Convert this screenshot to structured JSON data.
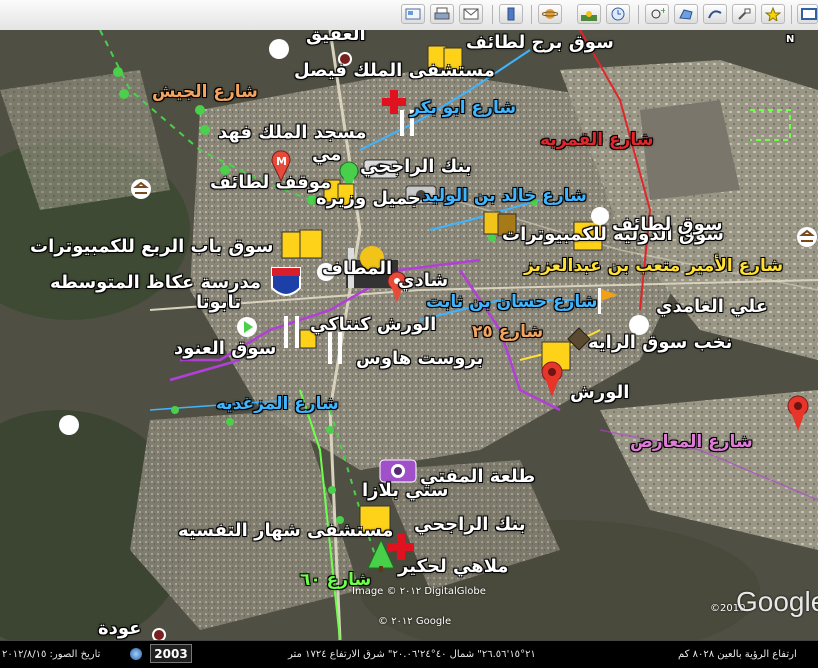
{
  "toolbar": {
    "buttons": [
      {
        "name": "email-icon"
      },
      {
        "name": "print-icon"
      },
      {
        "name": "mail-icon"
      },
      {
        "name": "sidebar-icon"
      },
      {
        "name": "planet-icon"
      },
      {
        "name": "sunlight-icon"
      },
      {
        "name": "historical-imagery-icon"
      },
      {
        "name": "placemark-add-icon"
      },
      {
        "name": "polygon-add-icon"
      },
      {
        "name": "path-add-icon"
      },
      {
        "name": "overlay-add-icon"
      },
      {
        "name": "tour-record-icon"
      },
      {
        "name": "map-view-icon"
      }
    ]
  },
  "map": {
    "compass": "N",
    "places": {
      "aqiq": "العقيق",
      "souq_burj": "سوق برج لطائف",
      "hosp_faisal": "مستشفى الملك فيصل",
      "masjid_fahd": "مسجد الملك فهد",
      "mawqif_line1": "مي",
      "mawqif_line2": "موقف لطائف",
      "bank_rajhi_top": "بنك الراجحي",
      "jamil_wazira": "جميل وزيره",
      "souq_dawla": "سوق الدوليه للكمبيوترات",
      "souq_taif": "سوق لطائف",
      "souq_bab": "سوق باب الربع للكمبيوترات",
      "school_okaz": "مدرسة عكاظ المتوسطه",
      "mataf": "المطاف",
      "shadi": "شادي",
      "tabuta": "تابوتا",
      "warsh_kentaki": "الورش كنتاكي",
      "ali_ghamdi": "علي الغامدي",
      "nukhb_souq": "نخب سوق الرايه",
      "souq_anood": "سوق العنود",
      "brost_house": "بروست هاوس",
      "warsh": "الورش",
      "talat_mufti": "طلعة المفتي",
      "city_plaza": "ستي بلازا",
      "bank_rajhi_bottom": "بنك الراجحي",
      "hosp_shahar": "مستشفى شهار التفسيه",
      "malahi": "ملاهي لحكير",
      "awda": "عودة"
    },
    "streets": {
      "jaish": "شارع الجيش",
      "abu_bakr": "شارع ابو بكر",
      "qamariya": "شارع القمريه",
      "khalid": "شارع خالد بن الوليد",
      "amir_mitab": "شارع الأمير متعب بن عبدالعزيز",
      "hassan": "شارع حسان بن ثابت",
      "st_25": "شارع ٢٥",
      "muzaghiba": "شارع المزغديه",
      "maarid": "شارع المعارض",
      "st_60": "شارع ٦٠"
    },
    "street_colors": {
      "jaish": "#f4a460",
      "abu_bakr": "#3fb5ff",
      "qamariya": "#e0262a",
      "khalid": "#3fb5ff",
      "amir_mitab": "#ffe033",
      "hassan": "#3fb5ff",
      "st_25": "#f4a460",
      "muzaghiba": "#3fb5ff",
      "maarid": "#e07ad8",
      "st_60": "#6dff4a"
    },
    "watermarks": {
      "image_credit": "Image © ٢٠١٢ DigitalGlobe",
      "google_credit": "© ٢٠١٢ Google",
      "google_logo": "Google",
      "year_small": "©2010"
    }
  },
  "status": {
    "imagery_date": "تاريخ الصور: ٢٠١٢/٨/١٥",
    "year": "2003",
    "coords": "٢١°١٥'٢٦.٥٦\" شمال  ٤٠°٢٤'٢٠.٠٦\" شرق  الارتفاع ١٧٢٤ متر",
    "eye_alt": "ارتفاع الرؤية بالعين ٨٠٢٨ كم"
  }
}
